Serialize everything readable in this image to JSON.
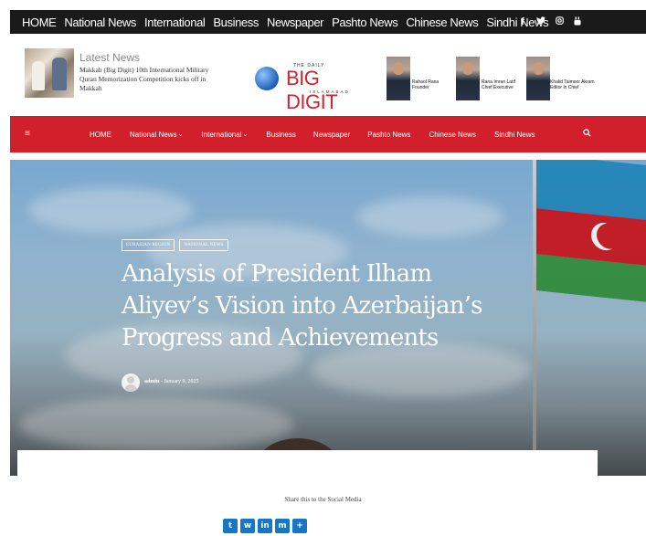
{
  "topbar": {
    "nav": [
      "HOME",
      "National News",
      "International",
      "Business",
      "Newspaper",
      "Pashto News",
      "Chinese News",
      "Sindhi News"
    ],
    "social_icons": [
      "facebook-icon",
      "twitter-icon",
      "instagram-icon",
      "youtube-icon"
    ]
  },
  "header": {
    "latest_title": "Latest News",
    "latest_text": "Makkah (Big Digit) 10th International Military Quran Memorization Competition kicks off in Makkah",
    "logo_small": "THE DAILY",
    "logo_big": "BIG DIGIT",
    "logo_sub": "ISLAMABAD",
    "people": [
      {
        "name": "Rahaol Rana",
        "role": "Founder"
      },
      {
        "name": "Rana Imran Latif",
        "role": "Chief Executive"
      },
      {
        "name": "Khalid Taimoor Akram",
        "role": "Editor in Chief"
      }
    ]
  },
  "rednav": {
    "hamburger": "≡",
    "items": [
      {
        "label": "HOME"
      },
      {
        "label": "National News",
        "caret": "⌄"
      },
      {
        "label": "International",
        "caret": "⌄"
      },
      {
        "label": "Business"
      },
      {
        "label": "Newspaper"
      },
      {
        "label": "Pashto News"
      },
      {
        "label": "Chinese News"
      },
      {
        "label": "Sindhi News"
      }
    ]
  },
  "article": {
    "tags": [
      "EURASIAN REGION",
      "NATIONAL NEWS"
    ],
    "title": "Analysis of President Ilham Aliyev’s Vision into Azerbaijan’s Progress and Achievements",
    "author": "admin",
    "separator": "-",
    "date": "January 9, 2025"
  },
  "share": {
    "label": "Share this to the Social Media",
    "icons": [
      {
        "name": "twitter-share-icon",
        "glyph": "t"
      },
      {
        "name": "whatsapp-share-icon",
        "glyph": "w"
      },
      {
        "name": "linkedin-share-icon",
        "glyph": "in"
      },
      {
        "name": "messenger-share-icon",
        "glyph": "m"
      },
      {
        "name": "add-share-icon",
        "glyph": "+"
      }
    ]
  },
  "colors": {
    "topbar": "#1a1a1a",
    "rednav": "#d1202b",
    "share_blue": "#1877c5"
  }
}
